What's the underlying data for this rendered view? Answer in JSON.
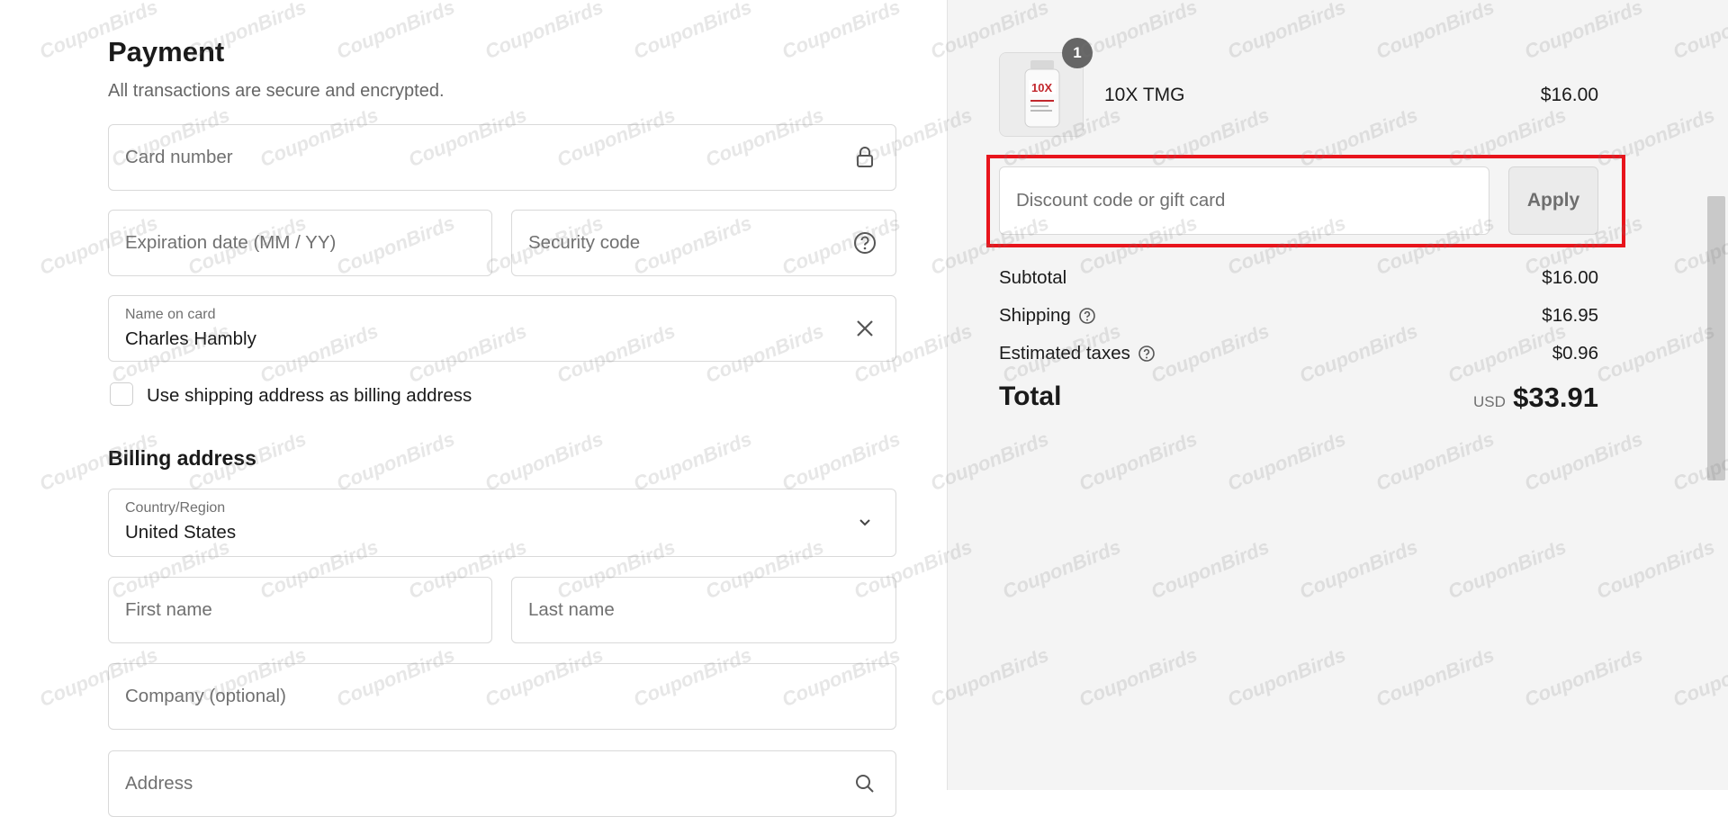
{
  "payment": {
    "title": "Payment",
    "subtitle": "All transactions are secure and encrypted.",
    "card_number_placeholder": "Card number",
    "expiration_placeholder": "Expiration date (MM / YY)",
    "security_code_placeholder": "Security code",
    "name_on_card_label": "Name on card",
    "name_on_card_value": "Charles Hambly",
    "use_shipping_label": "Use shipping address as billing address"
  },
  "billing": {
    "title": "Billing address",
    "country_label": "Country/Region",
    "country_value": "United States",
    "first_name_placeholder": "First name",
    "last_name_placeholder": "Last name",
    "company_placeholder": "Company (optional)",
    "address_placeholder": "Address"
  },
  "summary": {
    "product": {
      "quantity": "1",
      "name": "10X TMG",
      "price": "$16.00",
      "thumb_text": "10X"
    },
    "discount_placeholder": "Discount code or gift card",
    "apply_label": "Apply",
    "subtotal_label": "Subtotal",
    "subtotal_value": "$16.00",
    "shipping_label": "Shipping",
    "shipping_value": "$16.95",
    "taxes_label": "Estimated taxes",
    "taxes_value": "$0.96",
    "total_label": "Total",
    "total_currency": "USD",
    "total_value": "$33.91"
  },
  "watermark": "CouponBirds",
  "colors": {
    "highlight": "#e8141c",
    "panel_bg": "#f4f4f4"
  }
}
